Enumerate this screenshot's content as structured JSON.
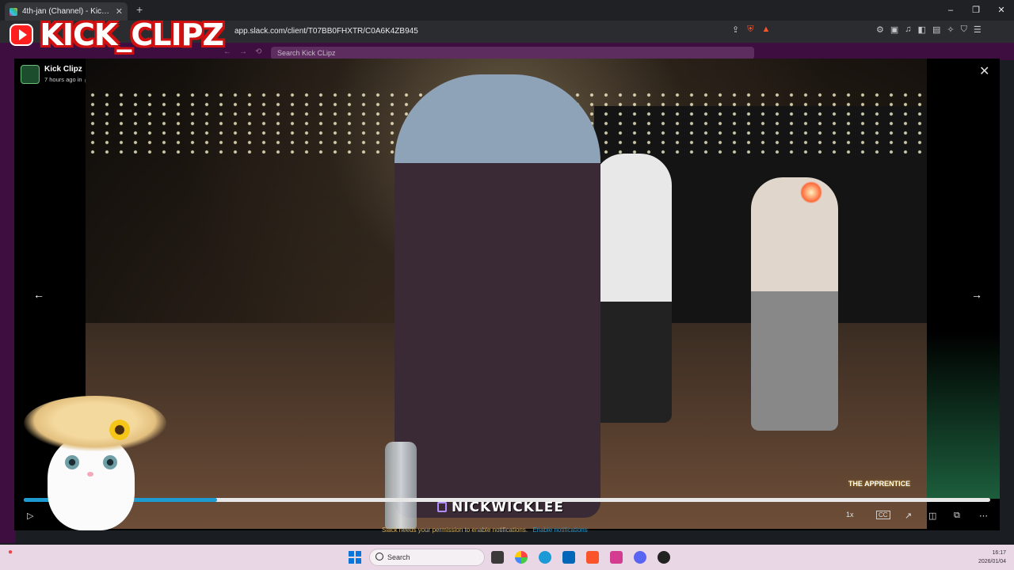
{
  "browser": {
    "tab_title": "4th-jan (Channel) - Kick Clips",
    "new_tab": "+",
    "url": "app.slack.com/client/T07BB0FHXTR/C0A6K4ZB945",
    "window_controls": [
      "–",
      "❐",
      "✕"
    ]
  },
  "slack": {
    "search_placeholder": "Search Kick CLipz"
  },
  "overlay": {
    "channel_logo": "KICK_CLIPZ",
    "streamer_tag": "NICKWICKLEE",
    "show_badge": "THE APPRENTICE"
  },
  "modal": {
    "title": "Kick Clipz",
    "meta": "7 hours ago in 🔒 4th-jan  – clip_01KE3FNAKB5KY0775HFEJX5AVK.mp4",
    "close": "✕",
    "prev": "←",
    "next": "→"
  },
  "player": {
    "progress": 0.2,
    "play": "▷",
    "speed": "1x",
    "cc": "CC",
    "notification": "Slack needs your permission to enable notifications.",
    "notification_link": "Enable notifications"
  },
  "taskbar": {
    "search_label": "Search",
    "time": "16:17",
    "date": "2026/01/04"
  },
  "colors": {
    "accent": "#1d9bd1",
    "slack_aubergine": "#3f0e40",
    "logo_red": "#d01010"
  }
}
